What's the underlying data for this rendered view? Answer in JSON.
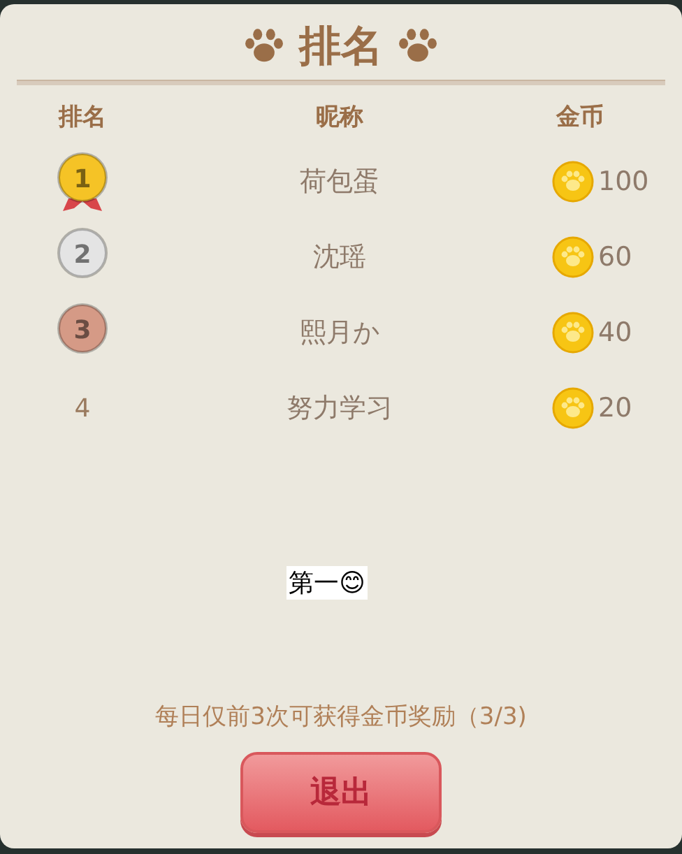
{
  "title": "排名",
  "columns": [
    "排名",
    "昵称",
    "金币"
  ],
  "rows": [
    {
      "kind": "medal",
      "color": "#f5c326",
      "ribbon": true,
      "rank": "1",
      "name": "荷包蛋",
      "coins": "100"
    },
    {
      "kind": "medal",
      "color": "#e4e4e4",
      "ribbon": false,
      "rank": "2",
      "name": "沈瑶",
      "coins": "60"
    },
    {
      "kind": "medal",
      "color": "#d59a86",
      "ribbon": false,
      "rank": "3",
      "name": "熙月か",
      "coins": "40"
    },
    {
      "kind": "number",
      "rank": "4",
      "name": "努力学习",
      "coins": "20"
    }
  ],
  "toast": "第一😊",
  "notice": "每日仅前3次可获得金币奖励（3/3)",
  "exit_button": "退出"
}
